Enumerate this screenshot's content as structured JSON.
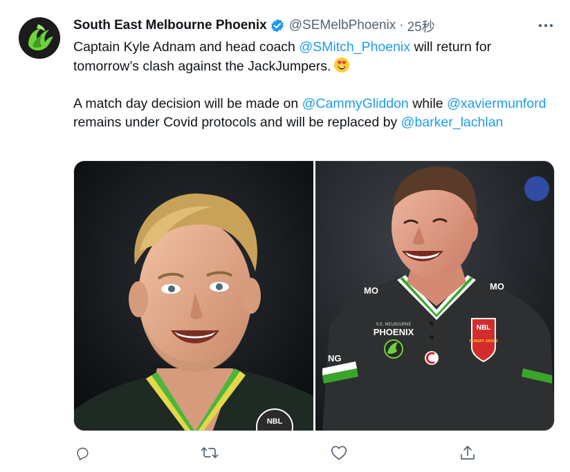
{
  "tweet": {
    "author_name": "South East Melbourne Phoenix",
    "handle": "@SEMelbPhoenix",
    "separator": "·",
    "time": "25秒",
    "verified_icon": "verified-badge-icon",
    "paragraph1": {
      "t1": "Captain Kyle Adnam and head coach ",
      "m1": "@SMitch_Phoenix",
      "t2": " will return for tomorrow’s clash against the JackJumpers."
    },
    "paragraph2": {
      "t1": "A match day decision will be made on ",
      "m1": "@CammyGliddon",
      "t2": " while ",
      "m2": "@xaviermunford",
      "t3": " remains under Covid protocols and will be replaced by ",
      "m3": "@barker_lachlan"
    },
    "emoji": "smiling-face-with-heart-eyes",
    "photo_left_jersey_text": "NBL",
    "photo_right_badge_text": "NBL",
    "photo_right_badge_sub": "HUNGRY JACK'S",
    "photo_right_chest": "PHOENIX",
    "photo_right_chest_top": "S.E. MELBOURNE",
    "photo_right_collar_left": "MO",
    "photo_right_collar_right": "MO",
    "photo_right_sleeve": "NG",
    "actions": [
      "reply-icon",
      "retweet-icon",
      "like-icon",
      "share-icon"
    ]
  },
  "colors": {
    "link": "#1d9bf0",
    "muted": "#536471",
    "verified": "#1d9bf0",
    "phoenix_green": "#4caf2a"
  }
}
